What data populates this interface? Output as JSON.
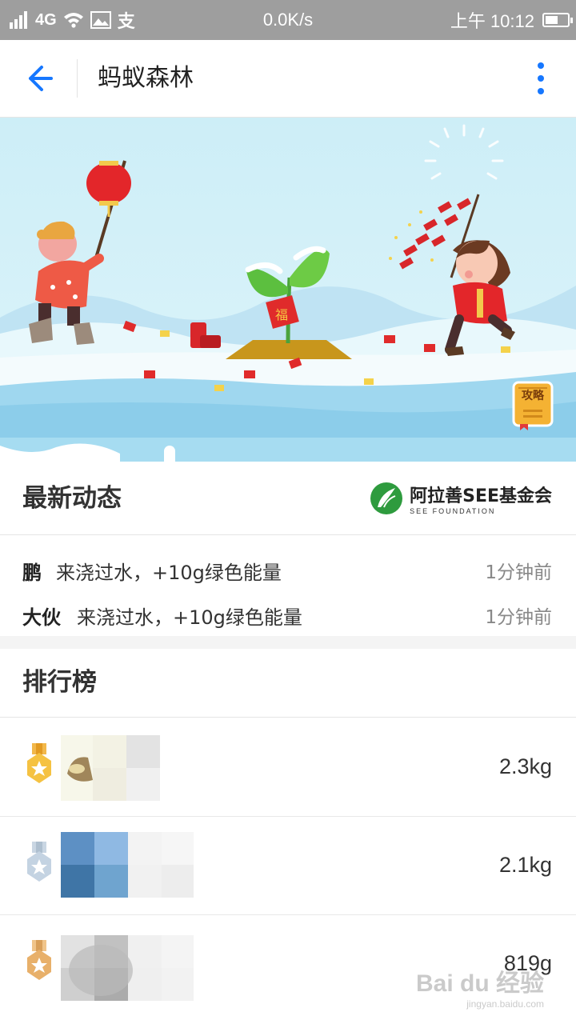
{
  "status_bar": {
    "network": "4G",
    "speed": "0.0K/s",
    "time": "上午 10:12"
  },
  "app_bar": {
    "title": "蚂蚁森林"
  },
  "banner": {
    "lantern_char": "福",
    "guide_label": "攻略"
  },
  "news": {
    "title": "最新动态",
    "partner_logo_text": "阿拉善SEE基金会",
    "partner_logo_sub": "SEE FOUNDATION",
    "items": [
      {
        "name": "鹏",
        "action": "来浇过水，+10g绿色能量",
        "time": "1分钟前"
      },
      {
        "name": "大伙",
        "action": "来浇过水，+10g绿色能量",
        "time": "1分钟前"
      }
    ]
  },
  "leaderboard": {
    "title": "排行榜",
    "rows": [
      {
        "rank": 1,
        "medal": "gold-medal-icon",
        "value": "2.3kg"
      },
      {
        "rank": 2,
        "medal": "silver-medal-icon",
        "value": "2.1kg"
      },
      {
        "rank": 3,
        "medal": "bronze-medal-icon",
        "value": "819g"
      }
    ]
  },
  "watermark": {
    "text": "Bai du 经验",
    "sub": "jingyan.baidu.com"
  },
  "colors": {
    "accent": "#1677ff",
    "status_bar": "#9e9e9e",
    "banner_sky": "#cdeef7"
  }
}
